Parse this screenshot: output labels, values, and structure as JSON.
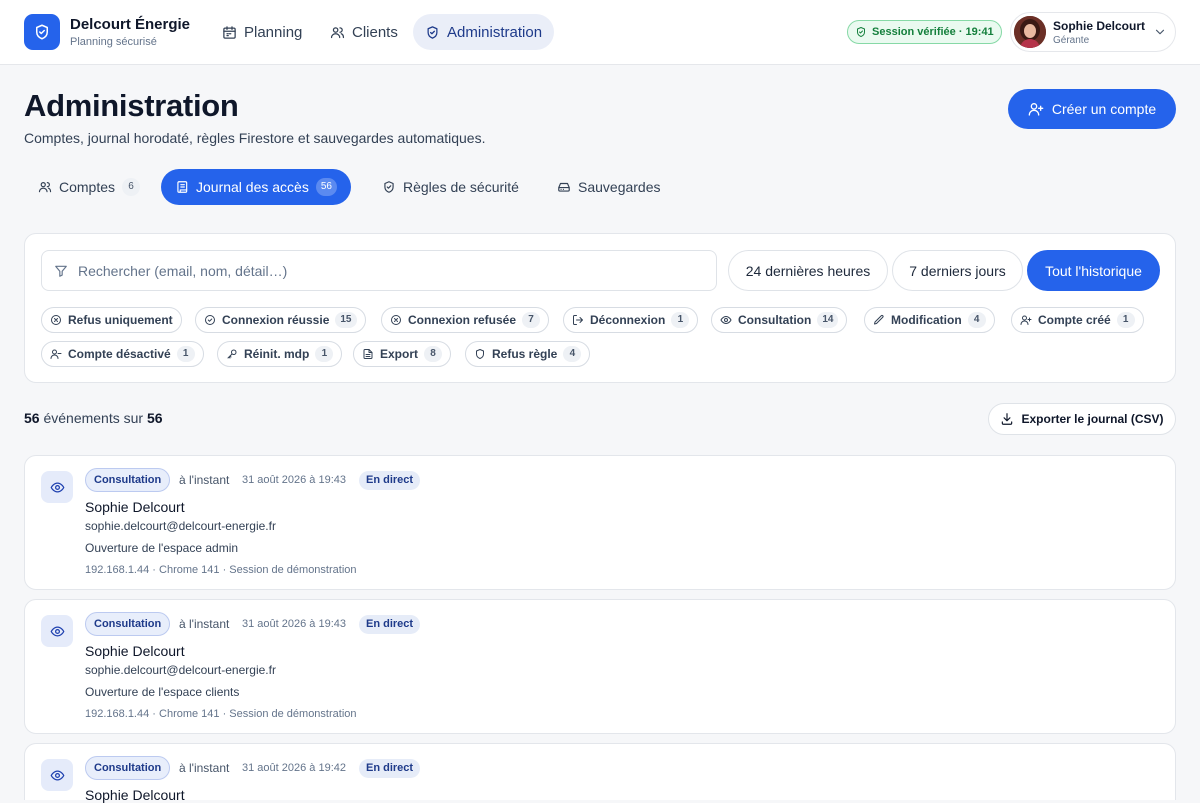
{
  "app": {
    "name": "Delcourt Énergie",
    "subtitle": "Planning sécurisé"
  },
  "nav": [
    {
      "label": "Planning",
      "icon": "calendar-icon",
      "active": false
    },
    {
      "label": "Clients",
      "icon": "users-icon",
      "active": false
    },
    {
      "label": "Administration",
      "icon": "shield-icon",
      "active": true
    }
  ],
  "session": {
    "label": "Session vérifiée · 19:41"
  },
  "user": {
    "name": "Sophie Delcourt",
    "role": "Gérante"
  },
  "page": {
    "title": "Administration",
    "subtitle": "Comptes, journal horodaté, règles Firestore et sauvegardes automatiques.",
    "create_button": "Créer un compte"
  },
  "tabs": [
    {
      "label": "Comptes",
      "count": "6",
      "active": false,
      "icon": "users-icon"
    },
    {
      "label": "Journal des accès",
      "count": "56",
      "active": true,
      "icon": "scroll-icon"
    },
    {
      "label": "Règles de sécurité",
      "count": "",
      "active": false,
      "icon": "shield-icon"
    },
    {
      "label": "Sauvegardes",
      "count": "",
      "active": false,
      "icon": "hard-drive-icon"
    }
  ],
  "filters": {
    "search_placeholder": "Rechercher (email, nom, détail…)",
    "ranges": [
      {
        "label": "24 dernières heures",
        "active": false
      },
      {
        "label": "7 derniers jours",
        "active": false
      },
      {
        "label": "Tout l'historique",
        "active": true
      }
    ],
    "chips": [
      {
        "label": "Refus uniquement",
        "count": "",
        "icon": "x-circle-icon"
      },
      {
        "label": "Connexion réussie",
        "count": "15",
        "icon": "check-circle-icon"
      },
      {
        "label": "Connexion refusée",
        "count": "7",
        "icon": "x-circle-icon"
      },
      {
        "label": "Déconnexion",
        "count": "1",
        "icon": "log-out-icon"
      },
      {
        "label": "Consultation",
        "count": "14",
        "icon": "eye-icon"
      },
      {
        "label": "Modification",
        "count": "4",
        "icon": "pencil-icon"
      },
      {
        "label": "Compte créé",
        "count": "1",
        "icon": "user-plus-icon"
      },
      {
        "label": "Compte désactivé",
        "count": "1",
        "icon": "user-minus-icon"
      },
      {
        "label": "Réinit. mdp",
        "count": "1",
        "icon": "key-icon"
      },
      {
        "label": "Export",
        "count": "8",
        "icon": "file-icon"
      },
      {
        "label": "Refus règle",
        "count": "4",
        "icon": "shield-icon"
      }
    ]
  },
  "results": {
    "shown": "56",
    "sep": "événements sur",
    "total": "56",
    "export_button": "Exporter le journal (CSV)"
  },
  "events": [
    {
      "type": "Consultation",
      "relative": "à l'instant",
      "date": "31 août 2026 à 19:43",
      "badge": "En direct",
      "name": "Sophie Delcourt",
      "email": "sophie.delcourt@delcourt-energie.fr",
      "detail": "Ouverture de l'espace admin",
      "meta": "192.168.1.44 · Chrome 141 · Session de démonstration"
    },
    {
      "type": "Consultation",
      "relative": "à l'instant",
      "date": "31 août 2026 à 19:43",
      "badge": "En direct",
      "name": "Sophie Delcourt",
      "email": "sophie.delcourt@delcourt-energie.fr",
      "detail": "Ouverture de l'espace clients",
      "meta": "192.168.1.44 · Chrome 141 · Session de démonstration"
    },
    {
      "type": "Consultation",
      "relative": "à l'instant",
      "date": "31 août 2026 à 19:42",
      "badge": "En direct",
      "name": "Sophie Delcourt",
      "email": "",
      "detail": "",
      "meta": ""
    }
  ],
  "colors": {
    "accent": "#2563eb",
    "success": "#15803d",
    "page_bg": "#f6f7f9"
  }
}
